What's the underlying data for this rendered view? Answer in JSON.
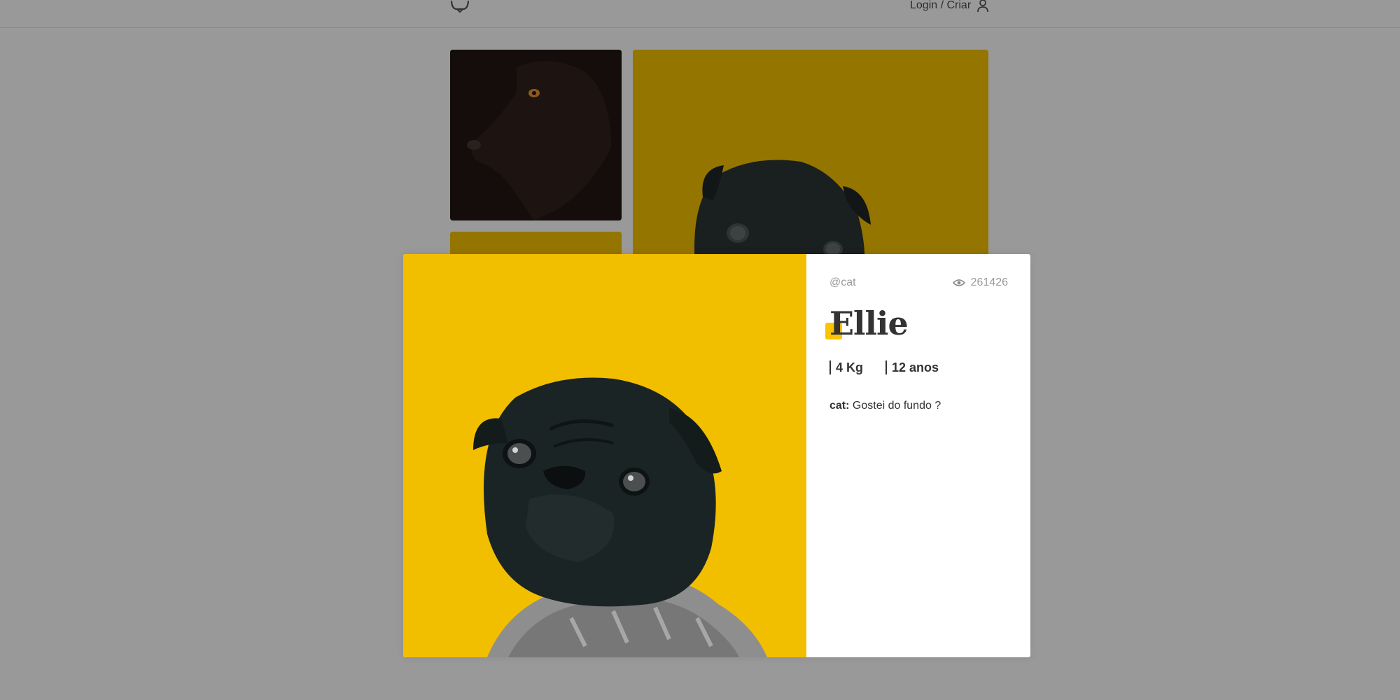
{
  "header": {
    "logo_icon": "dog-logo-icon",
    "login_label": "Login / Criar",
    "user_icon": "user-icon"
  },
  "feed": [
    {
      "description_icon": "black-dog-photo"
    },
    {
      "description_icon": "pug-yellow-photo"
    },
    {
      "description_icon": "yellow-photo"
    }
  ],
  "modal": {
    "author": "@cat",
    "views": "261426",
    "views_icon": "eye-icon",
    "title": "Ellie",
    "weight": "4 Kg",
    "age": "12 anos",
    "comments": [
      {
        "author": "cat:",
        "text": " Gostei do fundo ?"
      }
    ],
    "accent_color": "#fbc400",
    "photo_background": "#f2be00"
  }
}
